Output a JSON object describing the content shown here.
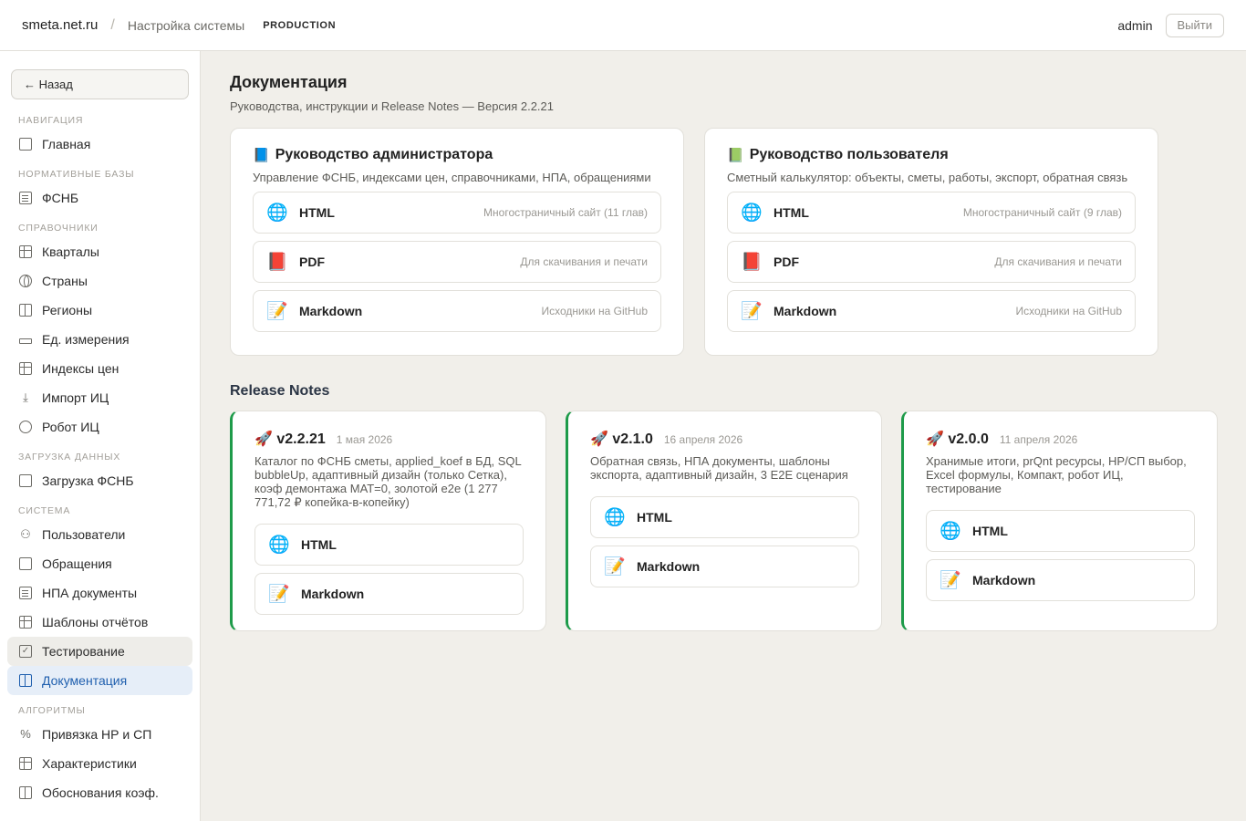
{
  "header": {
    "brand": "smeta.net.ru",
    "separator": "/",
    "breadcrumb": "Настройка системы",
    "env": "PRODUCTION",
    "user": "admin",
    "logout": "Выйти"
  },
  "sidebar": {
    "back": "← Назад",
    "sections": {
      "nav": "НАВИГАЦИЯ",
      "norm": "НОРМАТИВНЫЕ БАЗЫ",
      "ref": "СПРАВОЧНИКИ",
      "load": "ЗАГРУЗКА ДАННЫХ",
      "sys": "СИСТЕМА",
      "algo": "АЛГОРИТМЫ"
    },
    "items": {
      "home": "Главная",
      "fsnb": "ФСНБ",
      "quarters": "Кварталы",
      "countries": "Страны",
      "regions": "Регионы",
      "units": "Ед. измерения",
      "indexes": "Индексы цен",
      "import": "Импорт ИЦ",
      "robot": "Робот ИЦ",
      "load_fsnb": "Загрузка ФСНБ",
      "users": "Пользователи",
      "requests": "Обращения",
      "npa": "НПА документы",
      "templates": "Шаблоны отчётов",
      "testing": "Тестирование",
      "docs": "Документация",
      "binding": "Привязка НР и СП",
      "characteristics": "Характеристики",
      "justifications": "Обоснования коэф."
    }
  },
  "page": {
    "title": "Документация",
    "subtitle": "Руководства, инструкции и Release Notes — Версия 2.2.21"
  },
  "guides": [
    {
      "emoji": "📘",
      "title": "Руководство администратора",
      "desc": "Управление ФСНБ, индексами цен, справочниками, НПА, обращениями",
      "links": [
        {
          "emoji": "🌐",
          "name": "HTML",
          "note": "Многостраничный сайт (11 глав)"
        },
        {
          "emoji": "📕",
          "name": "PDF",
          "note": "Для скачивания и печати"
        },
        {
          "emoji": "📝",
          "name": "Markdown",
          "note": "Исходники на GitHub"
        }
      ]
    },
    {
      "emoji": "📗",
      "title": "Руководство пользователя",
      "desc": "Сметный калькулятор: объекты, сметы, работы, экспорт, обратная связь",
      "links": [
        {
          "emoji": "🌐",
          "name": "HTML",
          "note": "Многостраничный сайт (9 глав)"
        },
        {
          "emoji": "📕",
          "name": "PDF",
          "note": "Для скачивания и печати"
        },
        {
          "emoji": "📝",
          "name": "Markdown",
          "note": "Исходники на GitHub"
        }
      ]
    }
  ],
  "release_notes": {
    "title": "Release Notes",
    "items": [
      {
        "emoji": "🚀",
        "version": "v2.2.21",
        "date": "1 мая 2026",
        "desc": "Каталог по ФСНБ сметы, applied_koef в БД, SQL bubbleUp, адаптивный дизайн (только Сетка), коэф демонтажа МАТ=0, золотой e2e (1 277 771,72 ₽ копейка-в-копейку)",
        "links": [
          {
            "emoji": "🌐",
            "name": "HTML"
          },
          {
            "emoji": "📝",
            "name": "Markdown"
          }
        ]
      },
      {
        "emoji": "🚀",
        "version": "v2.1.0",
        "date": "16 апреля 2026",
        "desc": "Обратная связь, НПА документы, шаблоны экспорта, адаптивный дизайн, 3 E2E сценария",
        "links": [
          {
            "emoji": "🌐",
            "name": "HTML"
          },
          {
            "emoji": "📝",
            "name": "Markdown"
          }
        ]
      },
      {
        "emoji": "🚀",
        "version": "v2.0.0",
        "date": "11 апреля 2026",
        "desc": "Хранимые итоги, prQnt ресурсы, НР/СП выбор, Excel формулы, Компакт, робот ИЦ, тестирование",
        "links": [
          {
            "emoji": "🌐",
            "name": "HTML"
          },
          {
            "emoji": "📝",
            "name": "Markdown"
          }
        ]
      }
    ]
  },
  "colors": {
    "accent": "#1f5fae",
    "release_border": "#1e9b4a",
    "background": "#f1efea"
  }
}
